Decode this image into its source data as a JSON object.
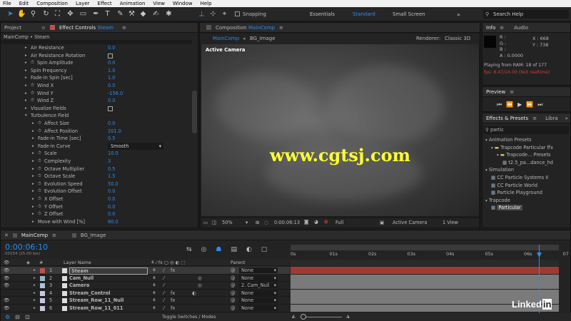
{
  "menu": [
    "File",
    "Edit",
    "Composition",
    "Layer",
    "Effect",
    "Animation",
    "View",
    "Window",
    "Help"
  ],
  "toolbar": {
    "snapping": "Snapping",
    "workspaces": [
      "Essentials",
      "Standard",
      "Small Screen"
    ],
    "search_placeholder": "Search Help"
  },
  "project_tab": "Project",
  "effect_tab_prefix": "Effect Controls",
  "effect_tab_layer": "Steam",
  "breadcrumb": "MainComp • Steam",
  "props": [
    {
      "n": "Air Resistance",
      "v": "0.0",
      "i": 1,
      "s": 0
    },
    {
      "n": "Air Resistance Rotation",
      "v": "",
      "i": 1,
      "s": 0,
      "cb": true
    },
    {
      "n": "Spin Amplitude",
      "v": "0.0",
      "i": 1,
      "s": 1
    },
    {
      "n": "Spin Frequency",
      "v": "1.0",
      "i": 1,
      "s": 0
    },
    {
      "n": "Fade-in Spin [sec]",
      "v": "1.0",
      "i": 1,
      "s": 0
    },
    {
      "n": "Wind X",
      "v": "0.0",
      "i": 1,
      "s": 1
    },
    {
      "n": "Wind Y",
      "v": "-156.0",
      "i": 1,
      "s": 1
    },
    {
      "n": "Wind Z",
      "v": "0.0",
      "i": 1,
      "s": 1
    },
    {
      "n": "Visualize Fields",
      "v": "",
      "i": 1,
      "s": 0,
      "cb": true
    },
    {
      "n": "Turbulence Field",
      "v": "",
      "i": 0,
      "s": 0,
      "open": true
    },
    {
      "n": "Affect Size",
      "v": "0.0",
      "i": 2,
      "s": 1
    },
    {
      "n": "Affect Position",
      "v": "201.0",
      "i": 2,
      "s": 1
    },
    {
      "n": "Fade-in Time [sec]",
      "v": "0.5",
      "i": 2,
      "s": 0
    },
    {
      "n": "Fade-in Curve",
      "v": "Smooth",
      "i": 2,
      "s": 0,
      "drop": true
    },
    {
      "n": "Scale",
      "v": "10.0",
      "i": 2,
      "s": 1
    },
    {
      "n": "Complexity",
      "v": "3",
      "i": 2,
      "s": 1
    },
    {
      "n": "Octave Multiplier",
      "v": "0.5",
      "i": 2,
      "s": 1
    },
    {
      "n": "Octave Scale",
      "v": "1.5",
      "i": 2,
      "s": 1
    },
    {
      "n": "Evolution Speed",
      "v": "50.0",
      "i": 2,
      "s": 1
    },
    {
      "n": "Evolution Offset",
      "v": "0.0",
      "i": 2,
      "s": 1
    },
    {
      "n": "X Offset",
      "v": "0.0",
      "i": 2,
      "s": 1
    },
    {
      "n": "Y Offset",
      "v": "0.0",
      "i": 2,
      "s": 1
    },
    {
      "n": "Z Offset",
      "v": "0.0",
      "i": 2,
      "s": 1
    },
    {
      "n": "Move with Wind [%]",
      "v": "80.0",
      "i": 2,
      "s": 0
    }
  ],
  "comp_panel": {
    "tab_prefix": "Composition",
    "tab_name": "MainComp",
    "subtabs": [
      "MainComp",
      "BG_Image"
    ],
    "renderer_label": "Renderer:",
    "renderer": "Classic 3D",
    "active_camera": "Active Camera",
    "watermark": "www.cgtsj.com",
    "zoom": "50%",
    "timecode": "0:00:06:13",
    "resolution": "Full",
    "view_camera": "Active Camera",
    "views": "1 View"
  },
  "info": {
    "tabs": [
      "Info",
      "Audio"
    ],
    "r": "R :",
    "g": "G :",
    "b": "B :",
    "a": "A : 0.0000",
    "x": "X : 668",
    "y": "Y : 738",
    "ram": "Playing from RAM: 18 of 177",
    "fps": "fps: 8.47/24.00 (Not realtime)"
  },
  "preview_tab": "Preview",
  "effects": {
    "tabs": [
      "Effects & Presets",
      "Libra"
    ],
    "search": "partic",
    "items": [
      {
        "t": "Animation Presets",
        "l": 0
      },
      {
        "t": "Trapcode Particular ffx",
        "l": 1
      },
      {
        "t": "Trapcode... Presets",
        "l": 2
      },
      {
        "t": "t2.5_pa...dance_hd",
        "l": 3
      },
      {
        "t": "Simulation",
        "l": 0
      },
      {
        "t": "CC Particle Systems II",
        "l": 1
      },
      {
        "t": "CC Particle World",
        "l": 1
      },
      {
        "t": "Particle Playground",
        "l": 1
      },
      {
        "t": "Trapcode",
        "l": 0
      },
      {
        "t": "Particular",
        "l": 1,
        "sel": true
      }
    ]
  },
  "timeline": {
    "tabs": [
      "MainComp",
      "BG_Image"
    ],
    "timecode": "0:00:06:10",
    "sub": "00154 (25.00 fps)",
    "header_name": "Layer Name",
    "header_parent": "Parent",
    "ruler": [
      "0s",
      "01s",
      "02s",
      "03s",
      "04s",
      "05s",
      "06s",
      "07"
    ],
    "toggle": "Toggle Switches / Modes",
    "layers": [
      {
        "n": "1",
        "name": "Steam",
        "color": "#c0504d",
        "parent": "None",
        "sel": true,
        "bar": "#9e3b31"
      },
      {
        "n": "2",
        "name": "Cam_Null",
        "color": "#9ab4c0",
        "parent": "None",
        "bar": "#7a7a7a"
      },
      {
        "n": "3",
        "name": "Camera",
        "color": "#a8c4d8",
        "parent": "2. Cam_Null",
        "bar": "#7a7a7a"
      },
      {
        "n": "4",
        "name": "Stream_Control",
        "color": "#c8c8dc",
        "parent": "None",
        "bar": "#7a7a7a"
      },
      {
        "n": "5",
        "name": "Stream_Row_11_Null",
        "color": "#c8c8dc",
        "parent": "None",
        "bar": "#7a7a7a"
      },
      {
        "n": "6",
        "name": "Stream_Row_11_011",
        "color": "#c8c8dc",
        "parent": "None",
        "bar": "#7a7a7a"
      }
    ]
  },
  "brand": "Linked in",
  "colors": {
    "accent": "#2d8ceb",
    "fps": "#d0402c"
  }
}
